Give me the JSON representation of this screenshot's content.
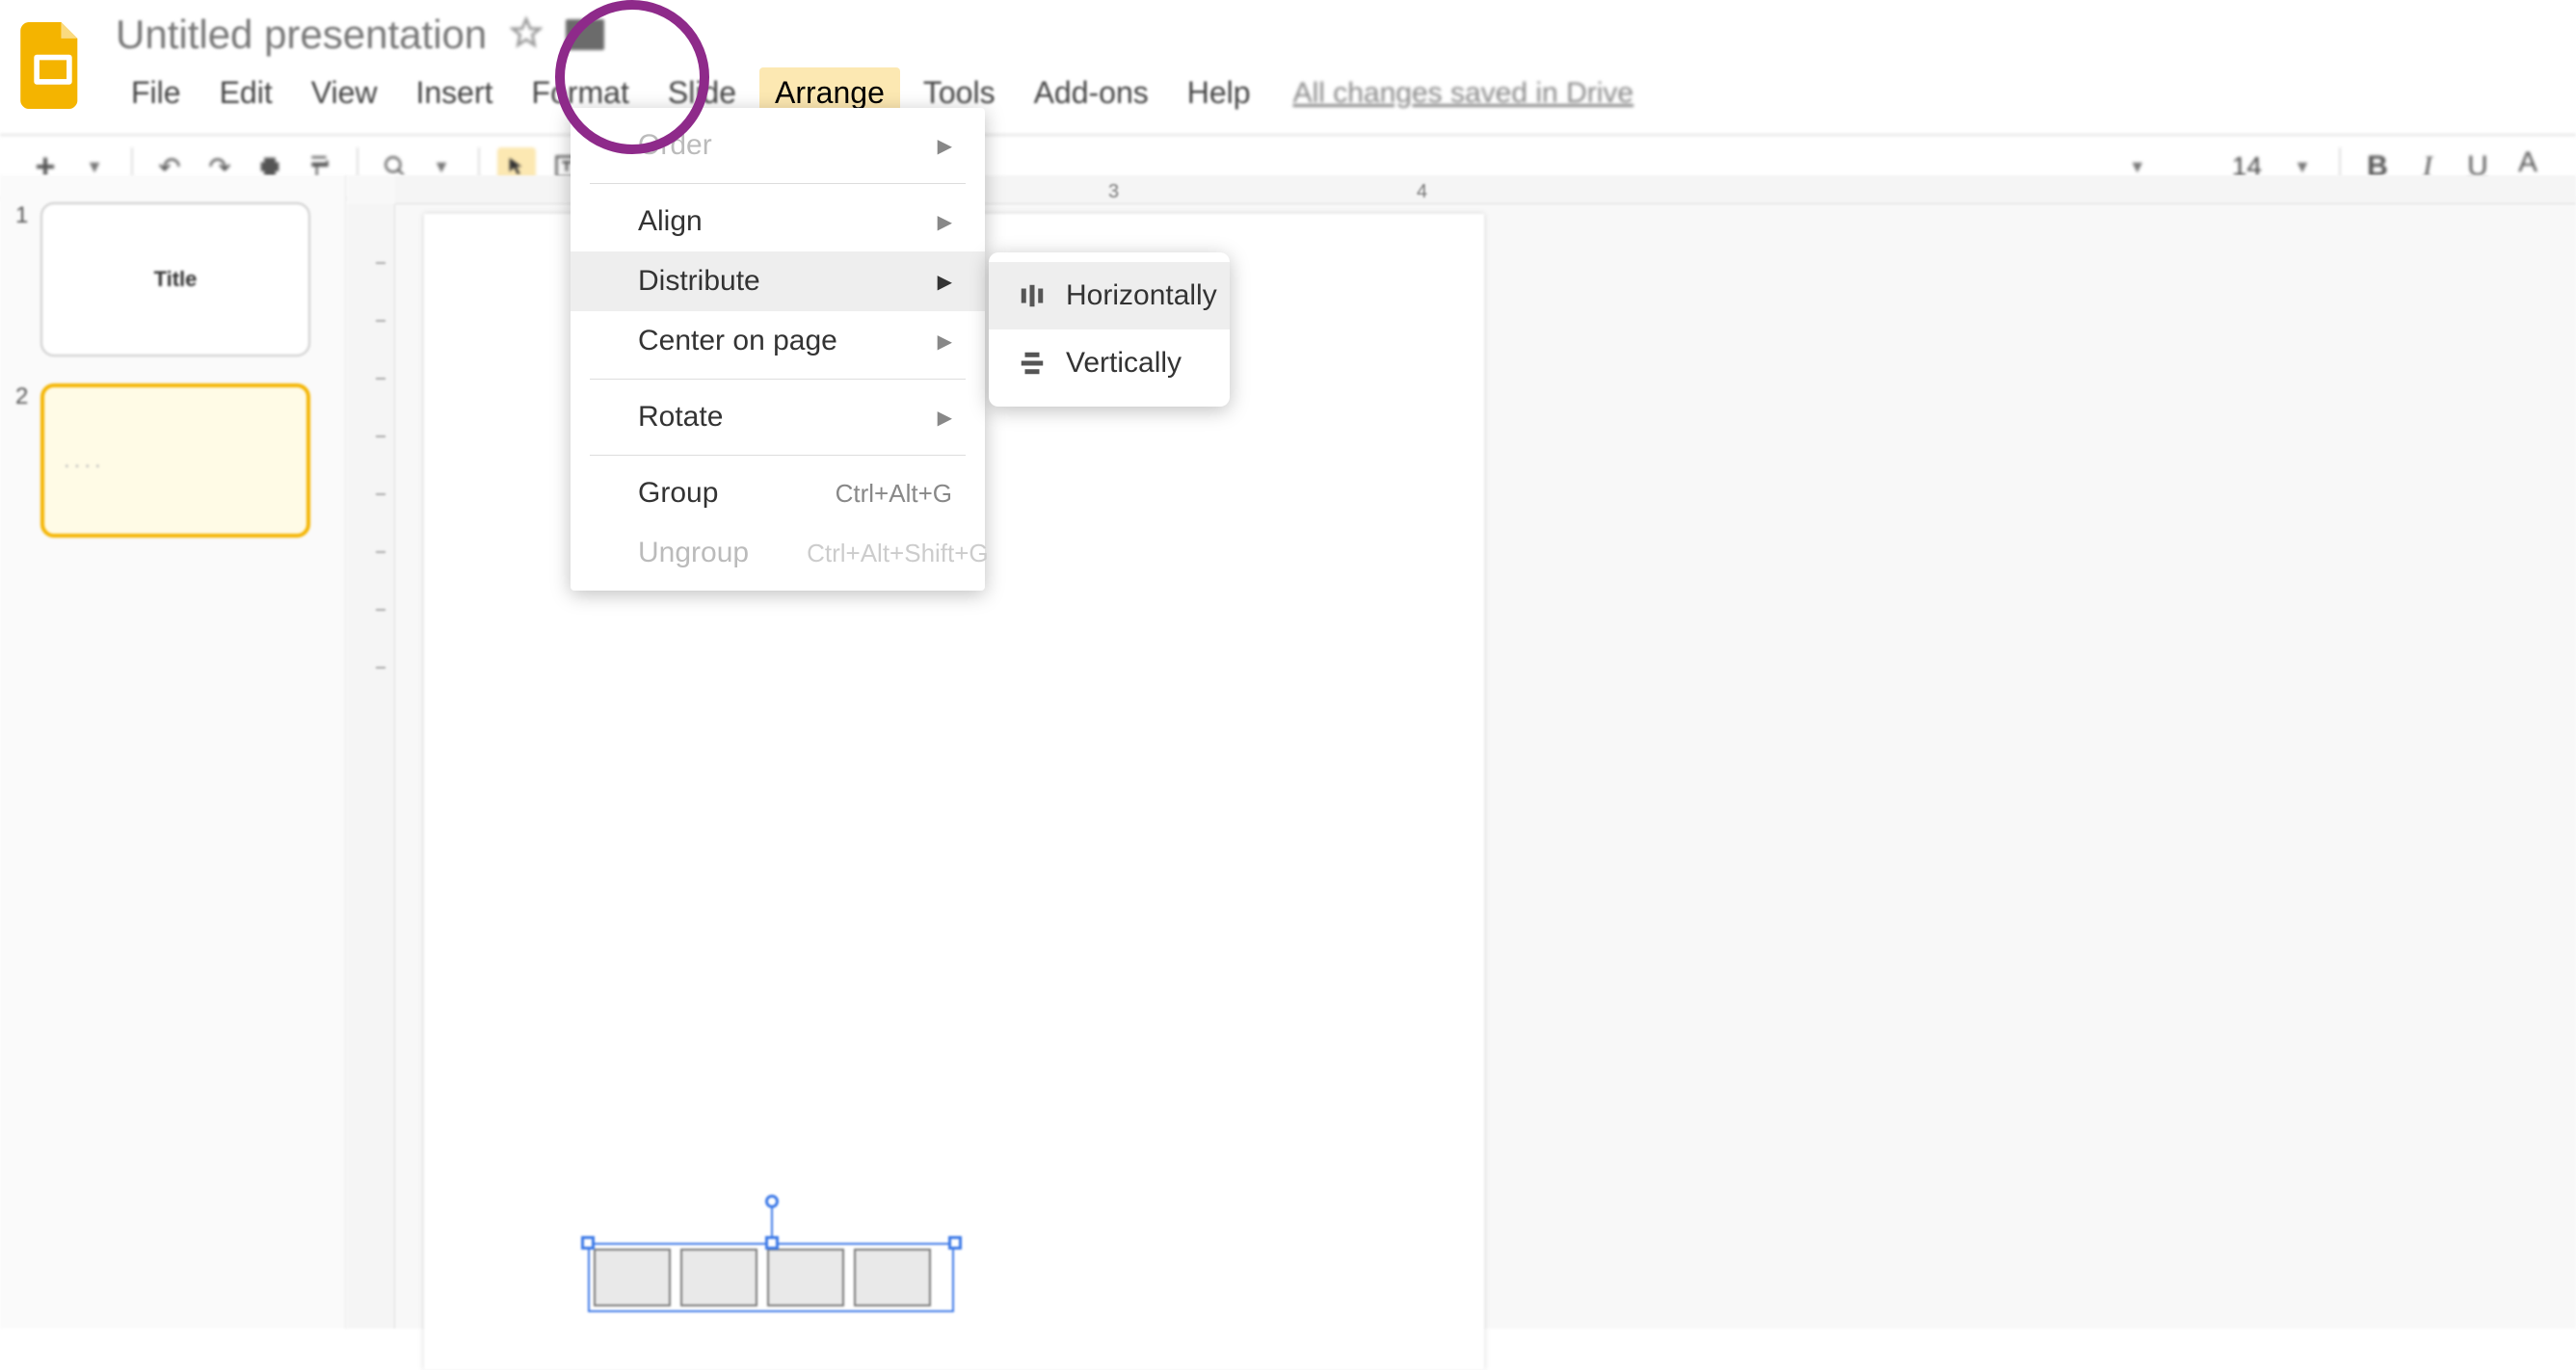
{
  "app": {
    "title": "Untitled presentation"
  },
  "menubar": {
    "items": [
      "File",
      "Edit",
      "View",
      "Insert",
      "Format",
      "Slide",
      "Arrange",
      "Tools",
      "Add-ons",
      "Help"
    ],
    "active_index": 6,
    "save_status": "All changes saved in Drive"
  },
  "toolbar": {
    "font_size": "14"
  },
  "thumbnails": {
    "items": [
      {
        "number": "1",
        "label": "Title",
        "selected": false
      },
      {
        "number": "2",
        "label": "....",
        "selected": true
      }
    ]
  },
  "ruler": {
    "marks": [
      "3",
      "4"
    ]
  },
  "arrange_menu": {
    "items": [
      {
        "label": "Order",
        "has_sub": true,
        "disabled": true
      },
      {
        "sep": true
      },
      {
        "label": "Align",
        "has_sub": true
      },
      {
        "label": "Distribute",
        "has_sub": true,
        "hover": true
      },
      {
        "label": "Center on page",
        "has_sub": true
      },
      {
        "sep": true
      },
      {
        "label": "Rotate",
        "has_sub": true
      },
      {
        "sep": true
      },
      {
        "label": "Group",
        "shortcut": "Ctrl+Alt+G"
      },
      {
        "label": "Ungroup",
        "shortcut": "Ctrl+Alt+Shift+G",
        "disabled": true
      }
    ]
  },
  "distribute_submenu": {
    "items": [
      {
        "label": "Horizontally",
        "icon": "dist-h",
        "hover": true
      },
      {
        "label": "Vertically",
        "icon": "dist-v"
      }
    ]
  }
}
